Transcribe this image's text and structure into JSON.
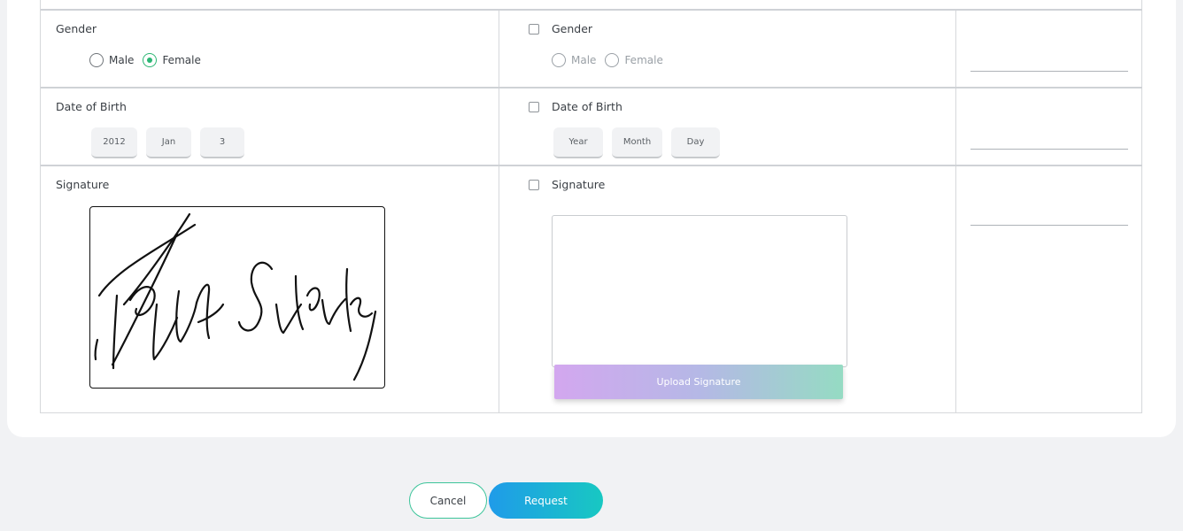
{
  "form": {
    "gender": {
      "label": "Gender",
      "options": [
        "Male",
        "Female"
      ],
      "selected": "Female"
    },
    "dob": {
      "label": "Date of Birth",
      "year": "2012",
      "month": "Jan",
      "day": "3"
    },
    "signature": {
      "label": "Signature"
    }
  },
  "edit": {
    "gender": {
      "label": "Gender",
      "options": [
        "Male",
        "Female"
      ]
    },
    "dob": {
      "label": "Date of Birth",
      "year_placeholder": "Year",
      "month_placeholder": "Month",
      "day_placeholder": "Day"
    },
    "signature": {
      "label": "Signature",
      "upload_label": "Upload Signature"
    }
  },
  "actions": {
    "cancel_label": "Cancel",
    "request_label": "Request"
  },
  "colors": {
    "accent_green": "#2bb673",
    "request_gradient_start": "#1f9be9",
    "request_gradient_end": "#18c8c2"
  }
}
